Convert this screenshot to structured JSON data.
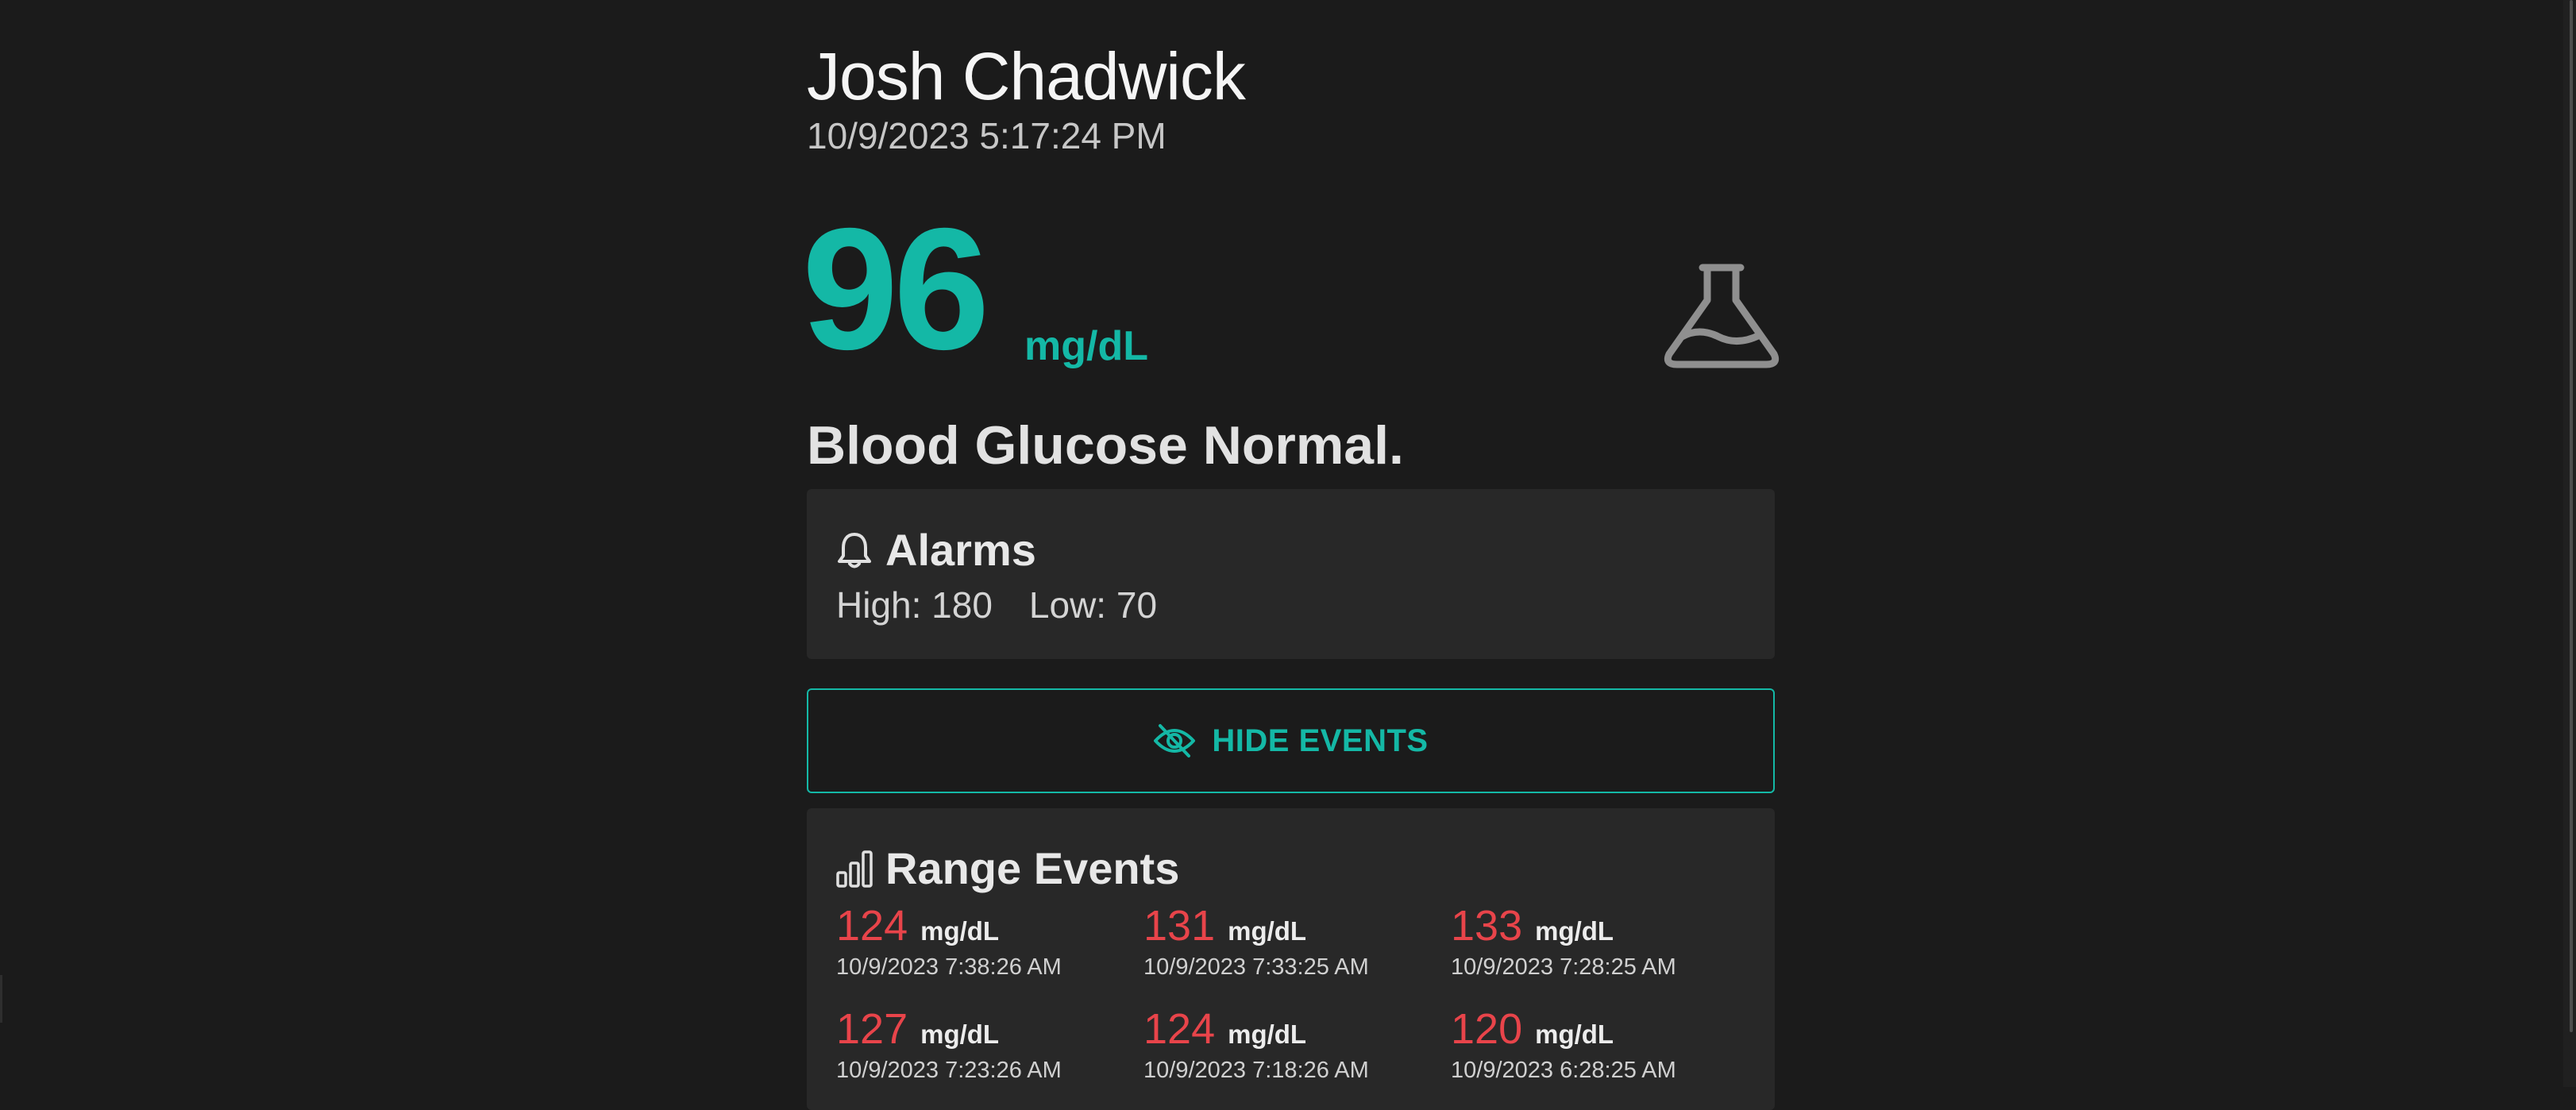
{
  "patient": {
    "name": "Josh Chadwick",
    "timestamp": "10/9/2023 5:17:24 PM"
  },
  "reading": {
    "value": "96",
    "unit": "mg/dL",
    "status": "Blood Glucose Normal.",
    "icon": "flask-icon"
  },
  "alarms": {
    "title": "Alarms",
    "icon": "bell-icon",
    "high_label": "High: 180",
    "low_label": "Low: 70"
  },
  "hide_events_button": {
    "label": "HIDE EVENTS",
    "icon": "eye-off-icon"
  },
  "range_events": {
    "title": "Range Events",
    "icon": "bar-chart-icon",
    "events": [
      {
        "value": "124",
        "unit": "mg/dL",
        "time": "10/9/2023 7:38:26 AM"
      },
      {
        "value": "131",
        "unit": "mg/dL",
        "time": "10/9/2023 7:33:25 AM"
      },
      {
        "value": "133",
        "unit": "mg/dL",
        "time": "10/9/2023 7:28:25 AM"
      },
      {
        "value": "127",
        "unit": "mg/dL",
        "time": "10/9/2023 7:23:26 AM"
      },
      {
        "value": "124",
        "unit": "mg/dL",
        "time": "10/9/2023 7:18:26 AM"
      },
      {
        "value": "120",
        "unit": "mg/dL",
        "time": "10/9/2023 6:28:25 AM"
      }
    ]
  },
  "colors": {
    "background": "#1b1b1b",
    "card": "#282828",
    "accent": "#14b8a6",
    "out_of_range": "#e8444a"
  }
}
